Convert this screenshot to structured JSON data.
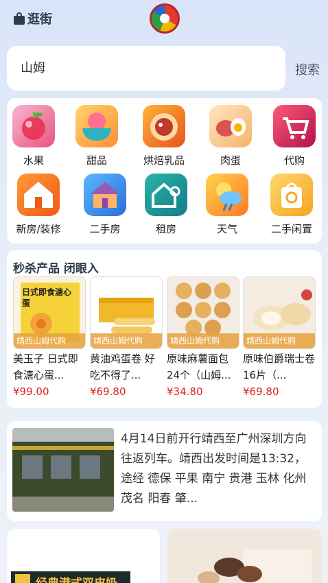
{
  "header": {
    "brand_label": "逛街",
    "logo_icon": "app-logo-icon"
  },
  "search": {
    "value": "山姆",
    "button_label": "搜索"
  },
  "categories": [
    {
      "label": "水果",
      "icon": "apple-icon"
    },
    {
      "label": "甜品",
      "icon": "dessert-bowl-icon"
    },
    {
      "label": "烘焙乳品",
      "icon": "pie-icon"
    },
    {
      "label": "肉蛋",
      "icon": "meat-egg-icon"
    },
    {
      "label": "代购",
      "icon": "shopping-cart-icon"
    },
    {
      "label": "新房/装修",
      "icon": "house-news-icon"
    },
    {
      "label": "二手房",
      "icon": "house-icon"
    },
    {
      "label": "租房",
      "icon": "house-key-icon"
    },
    {
      "label": "天气",
      "icon": "weather-icon"
    },
    {
      "label": "二手闲置",
      "icon": "recycle-bag-icon"
    }
  ],
  "flash_sale": {
    "title": "秒杀产品 闭眼入",
    "products": [
      {
        "name": "美玉子 日式即食溏心蛋...",
        "tag": "靖西山姆代购",
        "price": "¥99.00",
        "img_text": "日式即食溏心蛋"
      },
      {
        "name": "黄油鸡蛋卷 好吃不得了...",
        "tag": "靖西山姆代购",
        "price": "¥69.80"
      },
      {
        "name": "原味麻薯面包 24个（山姆...",
        "tag": "靖西山姆代购",
        "price": "¥34.80"
      },
      {
        "name": "原味伯爵瑞士卷 16片（...",
        "tag": "靖西山姆代购",
        "price": "¥69.80"
      }
    ]
  },
  "news": {
    "text": "4月14日前开行靖西至广州深圳方向往返列车。靖西出发时间是13:32，途经 德保 平果 南宁 贵港 玉林 化州 茂名 阳春 肇..."
  },
  "bottom": {
    "banner_text": "经典港式双皮奶"
  },
  "colors": {
    "price": "#e02020",
    "tag": "#e8a03c",
    "brand": "#2f3a4d"
  }
}
